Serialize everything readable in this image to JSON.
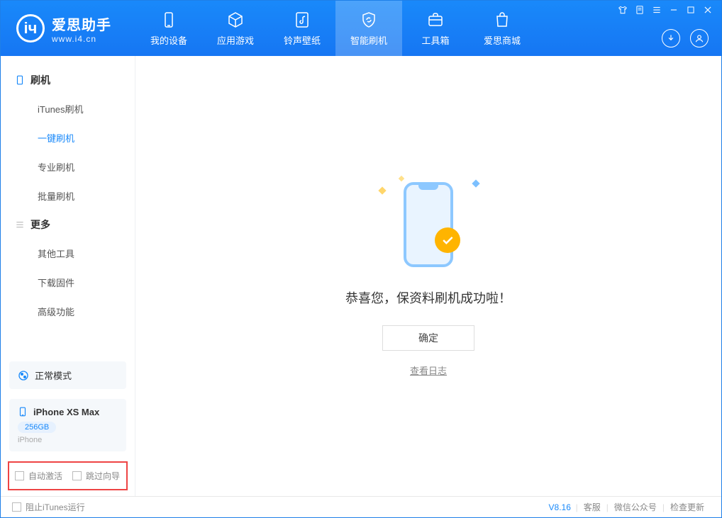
{
  "app": {
    "name_cn": "爱思助手",
    "url": "www.i4.cn"
  },
  "nav": {
    "items": [
      {
        "label": "我的设备"
      },
      {
        "label": "应用游戏"
      },
      {
        "label": "铃声壁纸"
      },
      {
        "label": "智能刷机"
      },
      {
        "label": "工具箱"
      },
      {
        "label": "爱思商城"
      }
    ]
  },
  "sidebar": {
    "section1_title": "刷机",
    "section1_items": [
      "iTunes刷机",
      "一键刷机",
      "专业刷机",
      "批量刷机"
    ],
    "section2_title": "更多",
    "section2_items": [
      "其他工具",
      "下载固件",
      "高级功能"
    ],
    "mode_label": "正常模式",
    "device": {
      "name": "iPhone XS Max",
      "storage": "256GB",
      "type": "iPhone"
    },
    "options": {
      "auto_activate": "自动激活",
      "skip_guide": "跳过向导"
    }
  },
  "main": {
    "success_text": "恭喜您，保资料刷机成功啦！",
    "ok_label": "确定",
    "log_link": "查看日志"
  },
  "statusbar": {
    "block_itunes": "阻止iTunes运行",
    "version": "V8.16",
    "links": [
      "客服",
      "微信公众号",
      "检查更新"
    ]
  }
}
